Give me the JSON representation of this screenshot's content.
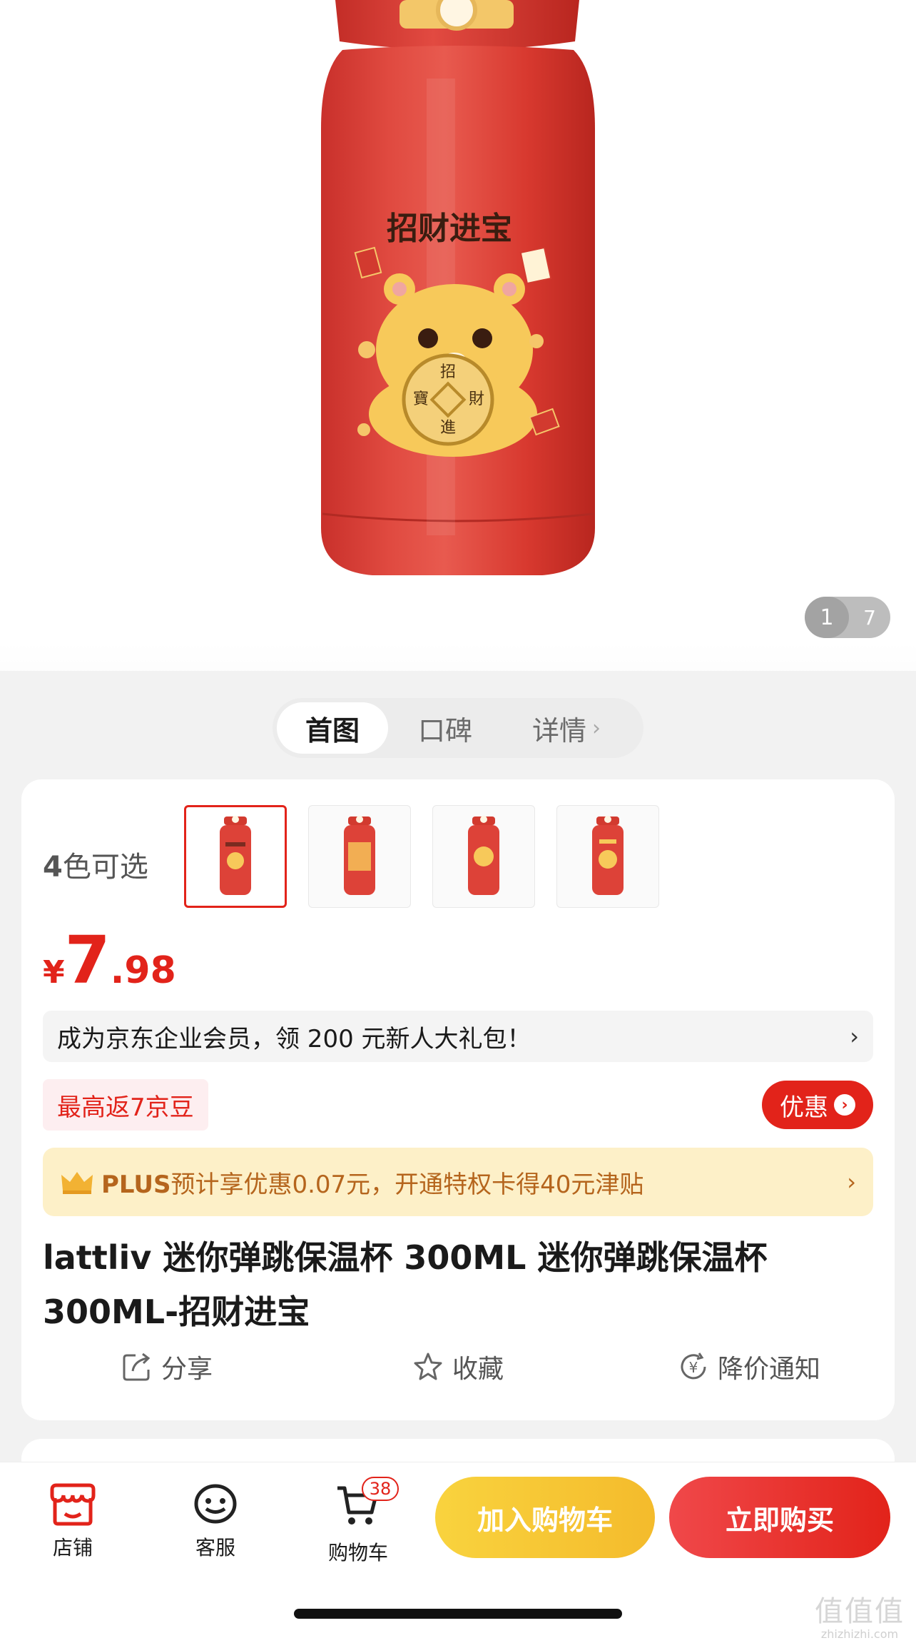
{
  "gallery": {
    "current": "1",
    "total": "7",
    "bottle_text": "招财进宝",
    "coin_chars": [
      "招",
      "財",
      "進",
      "寶"
    ]
  },
  "tabs": [
    {
      "label": "首图"
    },
    {
      "label": "口碑"
    },
    {
      "label": "详情"
    }
  ],
  "colors": {
    "count_num": "4",
    "label_rest": "色可选",
    "selected_index": 0
  },
  "price": {
    "symbol": "¥",
    "integer": "7",
    "decimal": ".98"
  },
  "member_banner": {
    "text": "成为京东企业会员，领 200 元新人大礼包！",
    "arrow": "›"
  },
  "bean_tag": "最高返7京豆",
  "promo_button": {
    "label": "优惠",
    "icon": "›"
  },
  "plus_banner": {
    "brand": "PLUS",
    "text": "预计享优惠0.07元，开通特权卡得40元津贴",
    "arrow": "›"
  },
  "product_title": "lattliv 迷你弹跳保温杯 300ML 迷你弹跳保温杯 300ML-招财进宝",
  "actions": [
    {
      "label": "分享",
      "icon": "share-icon"
    },
    {
      "label": "收藏",
      "icon": "star-icon"
    },
    {
      "label": "降价通知",
      "icon": "price-drop-icon"
    }
  ],
  "bottom_nav": {
    "shop": "店铺",
    "service": "客服",
    "cart": "购物车",
    "cart_badge": "38",
    "add_to_cart": "加入购物车",
    "buy_now": "立即购买"
  },
  "watermark": {
    "mark": "值值值",
    "site": "zhizhizhi.com"
  },
  "theme": {
    "accent": "#e2231a",
    "gold": "#f4bb2c",
    "plus_text": "#b5651d"
  }
}
